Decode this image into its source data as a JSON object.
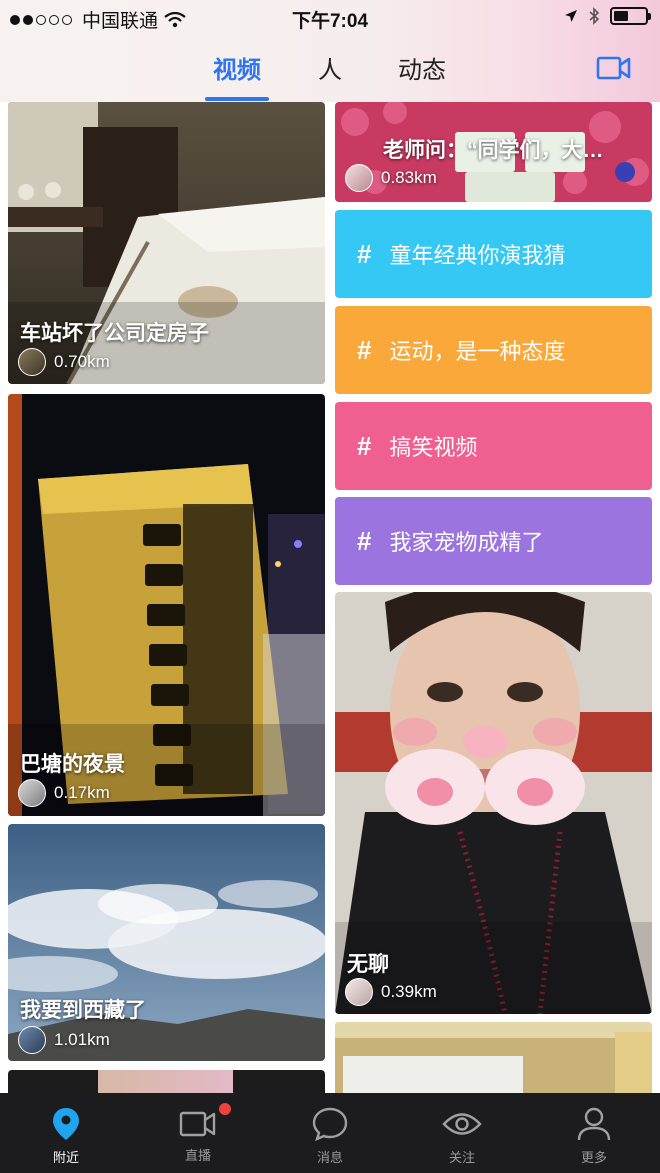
{
  "status_bar": {
    "carrier": "中国联通",
    "time": "下午7:04"
  },
  "top_tabs": [
    {
      "label": "视频",
      "active": true
    },
    {
      "label": "人",
      "active": false
    },
    {
      "label": "动态",
      "active": false
    }
  ],
  "camera_icon": "video-camera-icon",
  "accent_color": "#2f74f1",
  "left_column": [
    {
      "title": "车站坏了公司定房子",
      "distance": "0.70km"
    },
    {
      "title": "巴塘的夜景",
      "distance": "0.17km"
    },
    {
      "title": "我要到西藏了",
      "distance": "1.01km"
    }
  ],
  "right_column": {
    "top_card": {
      "title": "老师问：“同学们，大…",
      "distance": "0.83km"
    },
    "topics": [
      {
        "label": "童年经典你演我猜",
        "color": "#36c8f4"
      },
      {
        "label": "运动，是一种态度",
        "color": "#fba83a"
      },
      {
        "label": "搞笑视频",
        "color": "#ef5f8f"
      },
      {
        "label": "我家宠物成精了",
        "color": "#9b74e0"
      }
    ],
    "video_card": {
      "title": "无聊",
      "distance": "0.39km"
    }
  },
  "bottom_nav": [
    {
      "label": "附近",
      "icon": "location-pin-icon",
      "active": true
    },
    {
      "label": "直播",
      "icon": "video-camera-icon",
      "active": false,
      "badge": true
    },
    {
      "label": "消息",
      "icon": "chat-bubble-icon",
      "active": false
    },
    {
      "label": "关注",
      "icon": "eye-icon",
      "active": false
    },
    {
      "label": "更多",
      "icon": "person-icon",
      "active": false
    }
  ]
}
